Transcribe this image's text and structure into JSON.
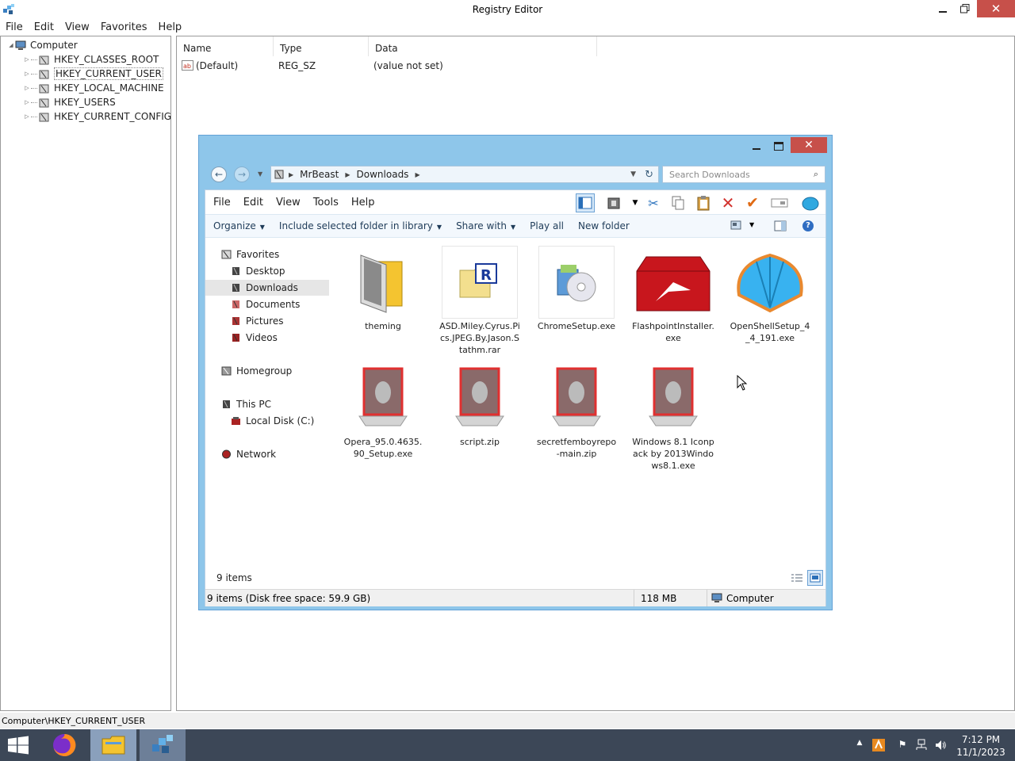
{
  "registry": {
    "title": "Registry Editor",
    "menu": [
      "File",
      "Edit",
      "View",
      "Favorites",
      "Help"
    ],
    "tree": {
      "root": "Computer",
      "children": [
        "HKEY_CLASSES_ROOT",
        "HKEY_CURRENT_USER",
        "HKEY_LOCAL_MACHINE",
        "HKEY_USERS",
        "HKEY_CURRENT_CONFIG"
      ]
    },
    "columns": [
      "Name",
      "Type",
      "Data"
    ],
    "values": [
      {
        "name": "(Default)",
        "type": "REG_SZ",
        "data": "(value not set)"
      }
    ],
    "status": "Computer\\HKEY_CURRENT_USER"
  },
  "explorer": {
    "address": {
      "segments": [
        "MrBeast",
        "Downloads"
      ]
    },
    "search_placeholder": "Search Downloads",
    "menu": [
      "File",
      "Edit",
      "View",
      "Tools",
      "Help"
    ],
    "commands": {
      "organize": "Organize",
      "include": "Include selected folder in library",
      "share": "Share with",
      "play_all": "Play all",
      "new_folder": "New folder"
    },
    "nav": {
      "favorites": "Favorites",
      "favorites_items": [
        "Desktop",
        "Downloads",
        "Documents",
        "Pictures",
        "Videos"
      ],
      "homegroup": "Homegroup",
      "this_pc": "This PC",
      "this_pc_items": [
        "Local Disk (C:)"
      ],
      "network": "Network"
    },
    "files": [
      {
        "name": "theming",
        "icon": "folder-icon"
      },
      {
        "name": "ASD.Miley.Cyrus.Pics.JPEG.By.Jason.Stathm.rar",
        "icon": "rar-archive-icon"
      },
      {
        "name": "ChromeSetup.exe",
        "icon": "setup-cd-icon"
      },
      {
        "name": "FlashpointInstaller.exe",
        "icon": "flashpoint-icon"
      },
      {
        "name": "OpenShellSetup_4_4_191.exe",
        "icon": "shell-icon"
      },
      {
        "name": "Opera_95.0.4635.90_Setup.exe",
        "icon": "alienware-icon"
      },
      {
        "name": "script.zip",
        "icon": "alienware-icon"
      },
      {
        "name": "secretfemboyrepo-main.zip",
        "icon": "alienware-icon"
      },
      {
        "name": "Windows 8.1 Iconpack by 2013Windows8.1.exe",
        "icon": "alienware-icon"
      }
    ],
    "item_count": "9 items",
    "status": {
      "summary": "9 items (Disk free space: 59.9 GB)",
      "size": "118 MB",
      "location": "Computer"
    }
  },
  "taskbar": {
    "apps": [
      "start-icon",
      "firefox-icon",
      "file-explorer-icon",
      "registry-editor-icon"
    ],
    "time": "7:12 PM",
    "date": "11/1/2023"
  },
  "colors": {
    "window_frame": "#8ec6ea",
    "close_button": "#c7504a",
    "taskbar": "#3c4757"
  }
}
